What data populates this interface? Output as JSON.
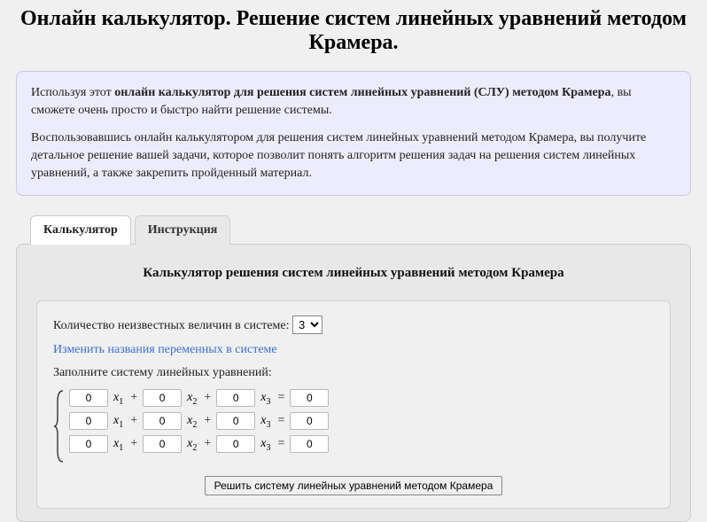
{
  "title": "Онлайн калькулятор. Решение систем линейных уравнений методом Крамера.",
  "intro": {
    "p1_before": "Используя этот ",
    "p1_bold": "онлайн калькулятор для решения систем линейных уравнений (СЛУ) методом Крамера",
    "p1_after": ", вы сможете очень просто и быстро найти решение системы.",
    "p2": "Воспользовавшись онлайн калькулятором для решения систем линейных уравнений методом Крамера, вы получите детальное решение вашей задачи, которое позволит понять алгоритм решения задач на решения систем линейных уравнений, а также закрепить пройденный материал."
  },
  "tabs": {
    "calc": "Калькулятор",
    "instr": "Инструкция"
  },
  "calc_heading": "Калькулятор решения систем линейных уравнений методом Крамера",
  "form": {
    "count_label": "Количество неизвестных величин в системе: ",
    "count_value": "3",
    "rename_link": "Изменить названия переменных в системе",
    "fill_label": "Заполните систему линейных уравнений:",
    "var_base": "x",
    "rows": [
      {
        "a1": "0",
        "a2": "0",
        "a3": "0",
        "b": "0"
      },
      {
        "a1": "0",
        "a2": "0",
        "a3": "0",
        "b": "0"
      },
      {
        "a1": "0",
        "a2": "0",
        "a3": "0",
        "b": "0"
      }
    ],
    "solve_button": "Решить систему линейных уравнений методом Крамера"
  }
}
